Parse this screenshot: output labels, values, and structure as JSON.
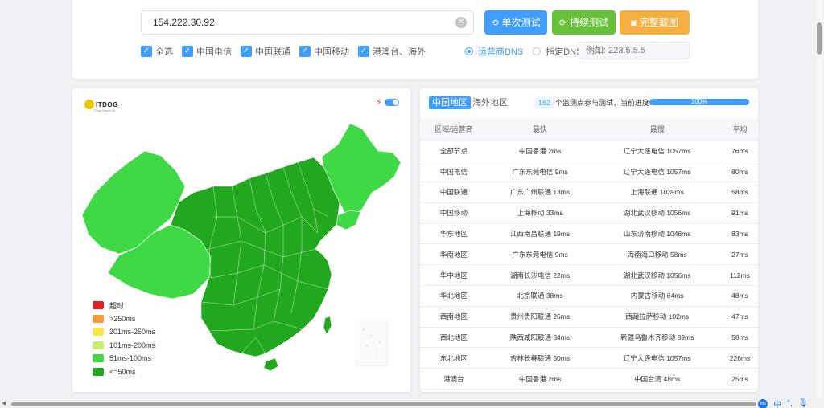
{
  "search": {
    "ip_value": "154.222.30.92"
  },
  "buttons": {
    "single": "单次测试",
    "continuous": "持续测试",
    "screenshot": "完整截图"
  },
  "filters": [
    {
      "label": "全选",
      "checked": true
    },
    {
      "label": "中国电信",
      "checked": true
    },
    {
      "label": "中国联通",
      "checked": true
    },
    {
      "label": "中国移动",
      "checked": true
    },
    {
      "label": "港澳台、海外",
      "checked": true
    }
  ],
  "dns": {
    "isp_label": "运营商DNS",
    "custom_label": "指定DNS:",
    "custom_placeholder": "例如: 223.5.5.5",
    "selected": "运营商DNS"
  },
  "map": {
    "logo": "ITDOG",
    "logo_sub": "Ping Check Kit",
    "legend": [
      {
        "label": "超时",
        "color": "#e02020"
      },
      {
        "label": ">250ms",
        "color": "#f29a3b"
      },
      {
        "label": "201ms-250ms",
        "color": "#f7e94d"
      },
      {
        "label": "101ms-200ms",
        "color": "#c8ef6a"
      },
      {
        "label": "51ms-100ms",
        "color": "#3fd946"
      },
      {
        "label": "<=50ms",
        "color": "#22a81f"
      }
    ]
  },
  "results": {
    "tabs": [
      "中国地区",
      "海外地区"
    ],
    "active_tab": "中国地区",
    "node_count": "162",
    "progress_text": "个监测点参与测试，当前进度：",
    "progress_label": "100%",
    "progress": 1.0,
    "headers": [
      "区域/运营商",
      "最快",
      "最慢",
      "平均"
    ],
    "rows": [
      [
        "全部节点",
        "中国香港 2ms",
        "辽宁大连电信 1057ms",
        "76ms"
      ],
      [
        "中国电信",
        "广东东莞电信 9ms",
        "辽宁大连电信 1057ms",
        "80ms"
      ],
      [
        "中国联通",
        "广东广州联通 13ms",
        "上海联通 1039ms",
        "58ms"
      ],
      [
        "中国移动",
        "上海移动 33ms",
        "湖北武汉移动 1056ms",
        "91ms"
      ],
      [
        "华东地区",
        "江西南昌联通 19ms",
        "山东济南移动 1046ms",
        "83ms"
      ],
      [
        "华南地区",
        "广东东莞电信 9ms",
        "海南海口移动 58ms",
        "27ms"
      ],
      [
        "华中地区",
        "湖南长沙电信 22ms",
        "湖北武汉移动 1056ms",
        "112ms"
      ],
      [
        "华北地区",
        "北京联通 38ms",
        "内蒙古移动 64ms",
        "48ms"
      ],
      [
        "西南地区",
        "贵州贵阳联通 26ms",
        "西藏拉萨移动 102ms",
        "47ms"
      ],
      [
        "西北地区",
        "陕西咸阳联通 34ms",
        "新疆乌鲁木齐移动 89ms",
        "58ms"
      ],
      [
        "东北地区",
        "吉林长春联通 50ms",
        "辽宁大连电信 1057ms",
        "226ms"
      ],
      [
        "港澳台",
        "中国香港 2ms",
        "中国台湾 48ms",
        "25ms"
      ]
    ]
  },
  "taskbar": {
    "ime_label": "中"
  }
}
